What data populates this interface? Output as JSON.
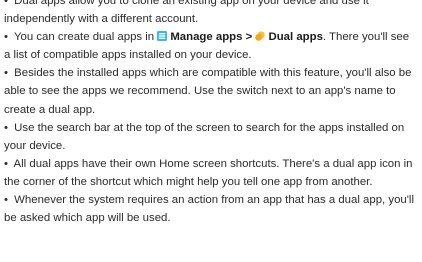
{
  "partial_top_line": "Dual apps",
  "bullet_symbol": "•",
  "items": [
    {
      "text": "Dual apps allow you to clone an existing app on your device and use it independently with a different account."
    },
    {
      "pre": "You can create dual apps in",
      "icon1": "manage-apps-icon",
      "link1": "Manage apps",
      "separator": ">",
      "icon2": "dual-apps-icon",
      "link2": "Dual apps",
      "post": ". There you'll see a list of compatible apps installed on your device."
    },
    {
      "text": "Besides the installed apps which are compatible with this feature, you'll also be able to see the apps we recommend. Use the switch next to an app's name to create a dual app."
    },
    {
      "text": "Use the search bar at the top of the screen to search for the apps installed on your device."
    },
    {
      "text": "All dual apps have their own Home screen shortcuts. There's a dual app icon in the corner of the shortcut which might help you tell one app from another."
    },
    {
      "text": "Whenever the system requires an action from an app that has a dual app, you'll be asked which app will be used."
    }
  ],
  "colors": {
    "text": "#2b2b2b",
    "manage_apps_icon": "#36b6ea",
    "dual_apps_icon": "#f7c325"
  }
}
